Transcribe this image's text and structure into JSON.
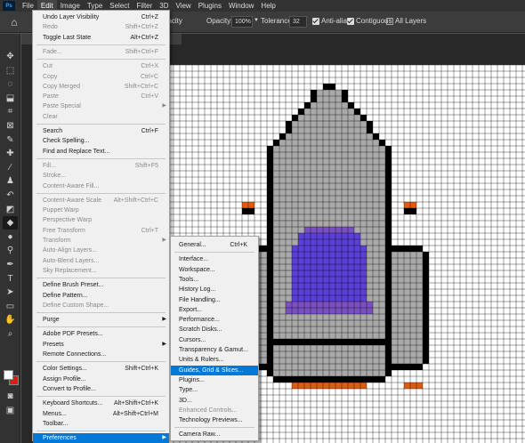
{
  "app": {
    "logo_text": "Ps"
  },
  "menubar": [
    "File",
    "Edit",
    "Image",
    "Type",
    "Select",
    "Filter",
    "3D",
    "View",
    "Plugins",
    "Window",
    "Help"
  ],
  "options_bar": {
    "mode_partial": "cpacity",
    "opacity_label": "Opacity:",
    "opacity_value": "100%",
    "tolerance_label": "Tolerance:",
    "tolerance_value": "32",
    "anti_alias_label": "Anti-alias",
    "contiguous_label": "Contiguous",
    "all_layers_label": "All Layers",
    "anti_alias_checked": true,
    "contiguous_checked": true,
    "all_layers_checked": false
  },
  "edit_menu": [
    {
      "label": "Undo Layer Visibility",
      "shortcut": "Ctrl+Z",
      "disabled": false
    },
    {
      "label": "Redo",
      "shortcut": "Shift+Ctrl+Z",
      "disabled": true
    },
    {
      "label": "Toggle Last State",
      "shortcut": "Alt+Ctrl+Z",
      "disabled": false
    },
    {
      "sep": true
    },
    {
      "label": "Fade...",
      "shortcut": "Shift+Ctrl+F",
      "disabled": true
    },
    {
      "sep": true
    },
    {
      "label": "Cut",
      "shortcut": "Ctrl+X",
      "disabled": true
    },
    {
      "label": "Copy",
      "shortcut": "Ctrl+C",
      "disabled": true
    },
    {
      "label": "Copy Merged",
      "shortcut": "Shift+Ctrl+C",
      "disabled": true
    },
    {
      "label": "Paste",
      "shortcut": "Ctrl+V",
      "disabled": true
    },
    {
      "label": "Paste Special",
      "shortcut": "",
      "disabled": true,
      "submenu": true
    },
    {
      "label": "Clear",
      "shortcut": "",
      "disabled": true
    },
    {
      "sep": true
    },
    {
      "label": "Search",
      "shortcut": "Ctrl+F",
      "disabled": false
    },
    {
      "label": "Check Spelling...",
      "shortcut": "",
      "disabled": false
    },
    {
      "label": "Find and Replace Text...",
      "shortcut": "",
      "disabled": false
    },
    {
      "sep": true
    },
    {
      "label": "Fill...",
      "shortcut": "Shift+F5",
      "disabled": true
    },
    {
      "label": "Stroke...",
      "shortcut": "",
      "disabled": true
    },
    {
      "label": "Content-Aware Fill...",
      "shortcut": "",
      "disabled": true
    },
    {
      "sep": true
    },
    {
      "label": "Content-Aware Scale",
      "shortcut": "Alt+Shift+Ctrl+C",
      "disabled": true
    },
    {
      "label": "Puppet Warp",
      "shortcut": "",
      "disabled": true
    },
    {
      "label": "Perspective Warp",
      "shortcut": "",
      "disabled": true
    },
    {
      "label": "Free Transform",
      "shortcut": "Ctrl+T",
      "disabled": true
    },
    {
      "label": "Transform",
      "shortcut": "",
      "disabled": true,
      "submenu": true
    },
    {
      "label": "Auto-Align Layers...",
      "shortcut": "",
      "disabled": true
    },
    {
      "label": "Auto-Blend Layers...",
      "shortcut": "",
      "disabled": true
    },
    {
      "label": "Sky Replacement...",
      "shortcut": "",
      "disabled": true
    },
    {
      "sep": true
    },
    {
      "label": "Define Brush Preset...",
      "shortcut": "",
      "disabled": false
    },
    {
      "label": "Define Pattern...",
      "shortcut": "",
      "disabled": false
    },
    {
      "label": "Define Custom Shape...",
      "shortcut": "",
      "disabled": true
    },
    {
      "sep": true
    },
    {
      "label": "Purge",
      "shortcut": "",
      "disabled": false,
      "submenu": true
    },
    {
      "sep": true
    },
    {
      "label": "Adobe PDF Presets...",
      "shortcut": "",
      "disabled": false
    },
    {
      "label": "Presets",
      "shortcut": "",
      "disabled": false,
      "submenu": true
    },
    {
      "label": "Remote Connections...",
      "shortcut": "",
      "disabled": false
    },
    {
      "sep": true
    },
    {
      "label": "Color Settings...",
      "shortcut": "Shift+Ctrl+K",
      "disabled": false
    },
    {
      "label": "Assign Profile...",
      "shortcut": "",
      "disabled": false
    },
    {
      "label": "Convert to Profile...",
      "shortcut": "",
      "disabled": false
    },
    {
      "sep": true
    },
    {
      "label": "Keyboard Shortcuts...",
      "shortcut": "Alt+Shift+Ctrl+K",
      "disabled": false
    },
    {
      "label": "Menus...",
      "shortcut": "Alt+Shift+Ctrl+M",
      "disabled": false
    },
    {
      "label": "Toolbar...",
      "shortcut": "",
      "disabled": false
    },
    {
      "sep": true
    },
    {
      "label": "Preferences",
      "shortcut": "",
      "disabled": false,
      "submenu": true,
      "highlight": true
    }
  ],
  "preferences_submenu": [
    {
      "label": "General...",
      "shortcut": "Ctrl+K",
      "disabled": false
    },
    {
      "sep": true
    },
    {
      "label": "Interface...",
      "shortcut": "",
      "disabled": false
    },
    {
      "label": "Workspace...",
      "shortcut": "",
      "disabled": false
    },
    {
      "label": "Tools...",
      "shortcut": "",
      "disabled": false
    },
    {
      "label": "History Log...",
      "shortcut": "",
      "disabled": false
    },
    {
      "label": "File Handling...",
      "shortcut": "",
      "disabled": false
    },
    {
      "label": "Export...",
      "shortcut": "",
      "disabled": false
    },
    {
      "label": "Performance...",
      "shortcut": "",
      "disabled": false
    },
    {
      "label": "Scratch Disks...",
      "shortcut": "",
      "disabled": false
    },
    {
      "label": "Cursors...",
      "shortcut": "",
      "disabled": false
    },
    {
      "label": "Transparency & Gamut...",
      "shortcut": "",
      "disabled": false
    },
    {
      "label": "Units & Rulers...",
      "shortcut": "",
      "disabled": false
    },
    {
      "label": "Guides, Grid & Slices...",
      "shortcut": "",
      "disabled": false,
      "highlight": true
    },
    {
      "label": "Plugins...",
      "shortcut": "",
      "disabled": false
    },
    {
      "label": "Type...",
      "shortcut": "",
      "disabled": false
    },
    {
      "label": "3D...",
      "shortcut": "",
      "disabled": false
    },
    {
      "label": "Enhanced Controls...",
      "shortcut": "",
      "disabled": true
    },
    {
      "label": "Technology Previews...",
      "shortcut": "",
      "disabled": false
    },
    {
      "sep": true
    },
    {
      "label": "Camera Raw...",
      "shortcut": "",
      "disabled": false
    }
  ],
  "tools": [
    "move-tool",
    "marquee-tool",
    "lasso-tool",
    "object-select-tool",
    "crop-tool",
    "frame-tool",
    "eyedropper-tool",
    "healing-brush-tool",
    "brush-tool",
    "clone-stamp-tool",
    "history-brush-tool",
    "eraser-tool",
    "paint-bucket-tool",
    "blur-tool",
    "dodge-tool",
    "pen-tool",
    "type-tool",
    "path-select-tool",
    "shape-tool",
    "hand-tool",
    "zoom-tool"
  ],
  "colors": {
    "rocket_body": "#a9a9a9",
    "rocket_outline": "#000000",
    "window_purple": "#5b3fd6",
    "window_shade": "#7a4fc0",
    "flame_orange": "#e05a12",
    "menu_highlight": "#0078d7",
    "foreground_color": "#ffffff",
    "background_color": "#e01919"
  }
}
